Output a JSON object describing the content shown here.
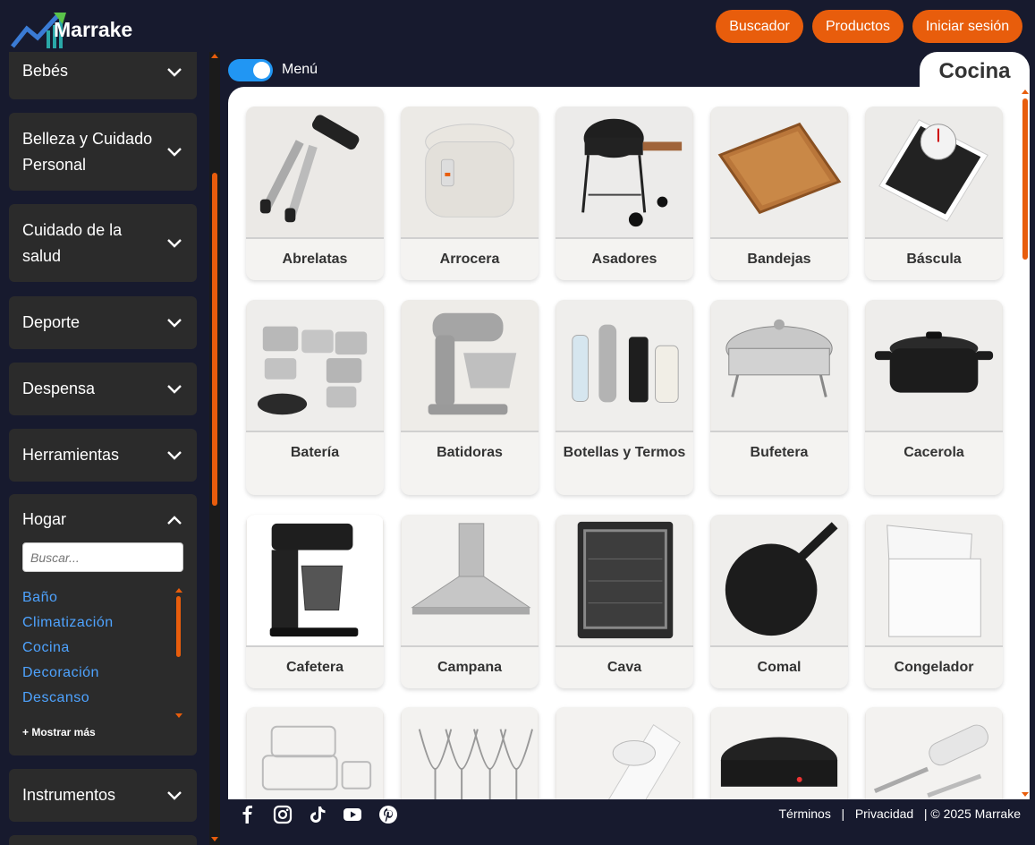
{
  "brand": {
    "name": "Marrake"
  },
  "nav": {
    "buscador": "Buscador",
    "productos": "Productos",
    "login": "Iniciar sesión"
  },
  "sidebar": {
    "categories": [
      "Bebés",
      "Belleza y Cuidado Personal",
      "Cuidado de la salud",
      "Deporte",
      "Despensa",
      "Herramientas",
      "Hogar",
      "Instrumentos"
    ],
    "expanded": "Hogar",
    "search_placeholder": "Buscar...",
    "sublinks": [
      "Baño",
      "Climatización",
      "Cocina",
      "Decoración",
      "Descanso"
    ],
    "show_more": "+ Mostrar más"
  },
  "menu_toggle": {
    "label": "Menú",
    "on": true
  },
  "page": {
    "tab_title": "Cocina"
  },
  "products": [
    "Abrelatas",
    "Arrocera",
    "Asadores",
    "Bandejas",
    "Báscula",
    "Batería",
    "Batidoras",
    "Botellas y Termos",
    "Bufetera",
    "Cacerola",
    "Cafetera",
    "Campana",
    "Cava",
    "Comal",
    "Congelador"
  ],
  "footer": {
    "terminos": "Términos",
    "sep1": "|",
    "privacidad": "Privacidad",
    "copyright": "| © 2025 Marrake",
    "social": [
      "facebook-icon",
      "instagram-icon",
      "tiktok-icon",
      "youtube-icon",
      "pinterest-icon"
    ]
  },
  "colors": {
    "accent": "#e85d0c",
    "background": "#171a2e",
    "link": "#4ea3ff",
    "toggle": "#2196f3"
  }
}
